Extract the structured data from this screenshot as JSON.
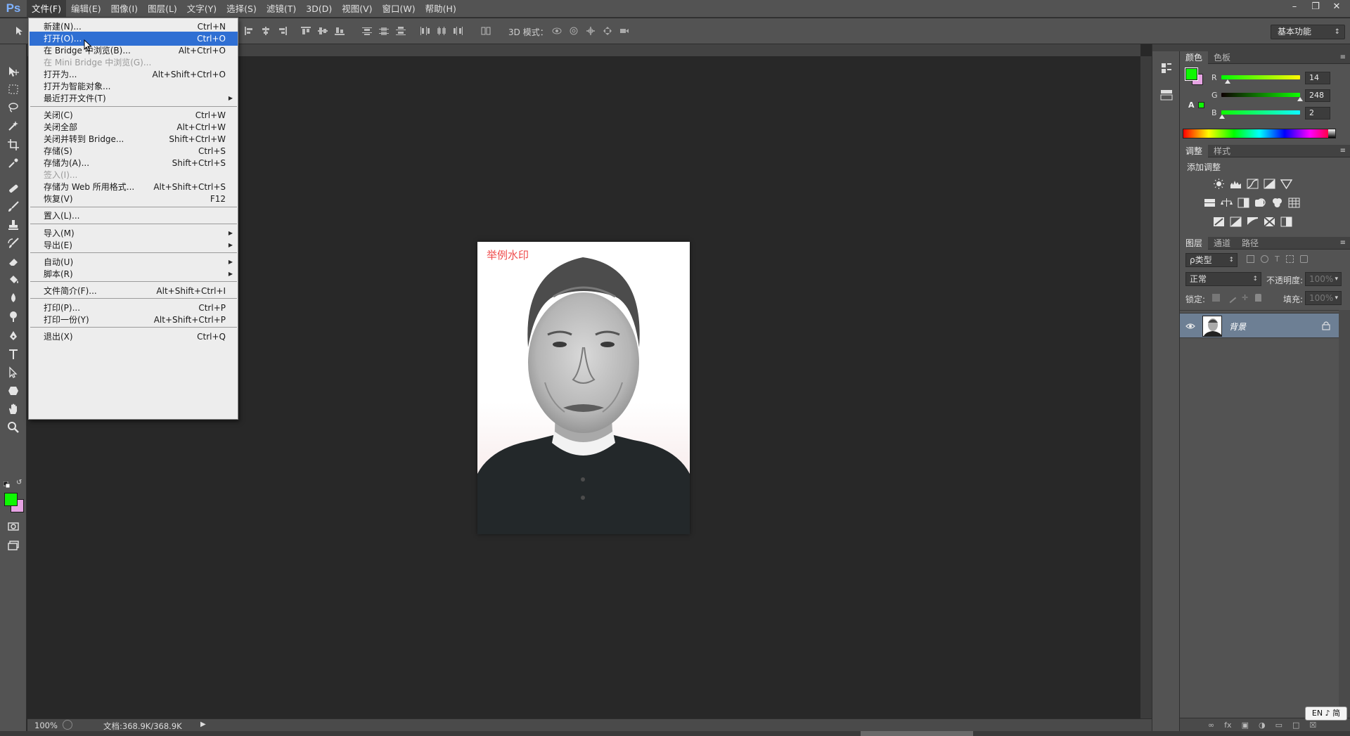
{
  "app": {
    "logo": "Ps"
  },
  "menubar": {
    "items": [
      "文件(F)",
      "编辑(E)",
      "图像(I)",
      "图层(L)",
      "文字(Y)",
      "选择(S)",
      "滤镜(T)",
      "3D(D)",
      "视图(V)",
      "窗口(W)",
      "帮助(H)"
    ],
    "active_index": 0
  },
  "options_bar": {
    "mode_3d_label": "3D 模式：",
    "workspace": "基本功能"
  },
  "file_menu": {
    "items": [
      {
        "label": "新建(N)...",
        "shortcut": "Ctrl+N"
      },
      {
        "label": "打开(O)...",
        "shortcut": "Ctrl+O",
        "highlighted": true
      },
      {
        "label": "在 Bridge 中浏览(B)...",
        "shortcut": "Alt+Ctrl+O"
      },
      {
        "label": "在 Mini Bridge 中浏览(G)...",
        "shortcut": "",
        "disabled": true
      },
      {
        "label": "打开为...",
        "shortcut": "Alt+Shift+Ctrl+O"
      },
      {
        "label": "打开为智能对象...",
        "shortcut": ""
      },
      {
        "label": "最近打开文件(T)",
        "shortcut": "",
        "submenu": true
      },
      {
        "label": "关闭(C)",
        "shortcut": "Ctrl+W"
      },
      {
        "label": "关闭全部",
        "shortcut": "Alt+Ctrl+W"
      },
      {
        "label": "关闭并转到 Bridge...",
        "shortcut": "Shift+Ctrl+W"
      },
      {
        "label": "存储(S)",
        "shortcut": "Ctrl+S"
      },
      {
        "label": "存储为(A)...",
        "shortcut": "Shift+Ctrl+S"
      },
      {
        "label": "签入(I)...",
        "shortcut": "",
        "disabled": true
      },
      {
        "label": "存储为 Web 所用格式...",
        "shortcut": "Alt+Shift+Ctrl+S"
      },
      {
        "label": "恢复(V)",
        "shortcut": "F12"
      },
      {
        "label": "置入(L)...",
        "shortcut": ""
      },
      {
        "label": "导入(M)",
        "shortcut": "",
        "submenu": true
      },
      {
        "label": "导出(E)",
        "shortcut": "",
        "submenu": true
      },
      {
        "label": "自动(U)",
        "shortcut": "",
        "submenu": true
      },
      {
        "label": "脚本(R)",
        "shortcut": "",
        "submenu": true
      },
      {
        "label": "文件简介(F)...",
        "shortcut": "Alt+Shift+Ctrl+I"
      },
      {
        "label": "打印(P)...",
        "shortcut": "Ctrl+P"
      },
      {
        "label": "打印一份(Y)",
        "shortcut": "Alt+Shift+Ctrl+P"
      },
      {
        "label": "退出(X)",
        "shortcut": "Ctrl+Q"
      }
    ]
  },
  "document": {
    "watermark": "举例水印"
  },
  "status_bar": {
    "zoom": "100%",
    "doc_info": "文档:368.9K/368.9K"
  },
  "color_panel": {
    "tabs": [
      "颜色",
      "色板"
    ],
    "foreground": "#0ef802",
    "background": "#e6a3e3",
    "channels": [
      {
        "label": "R",
        "value": "14"
      },
      {
        "label": "G",
        "value": "248"
      },
      {
        "label": "B",
        "value": "2"
      }
    ]
  },
  "adjustments_panel": {
    "tabs": [
      "调整",
      "样式"
    ],
    "title": "添加调整"
  },
  "layers_panel": {
    "tabs": [
      "图层",
      "通道",
      "路径"
    ],
    "filter": "ρ类型",
    "blend_mode": "正常",
    "opacity_label": "不透明度:",
    "opacity_value": "100%",
    "lock_label": "锁定:",
    "fill_label": "填充:",
    "fill_value": "100%",
    "layers": [
      {
        "name": "背景"
      }
    ]
  },
  "taskbar": {
    "ime": "EN ♪ 简"
  }
}
